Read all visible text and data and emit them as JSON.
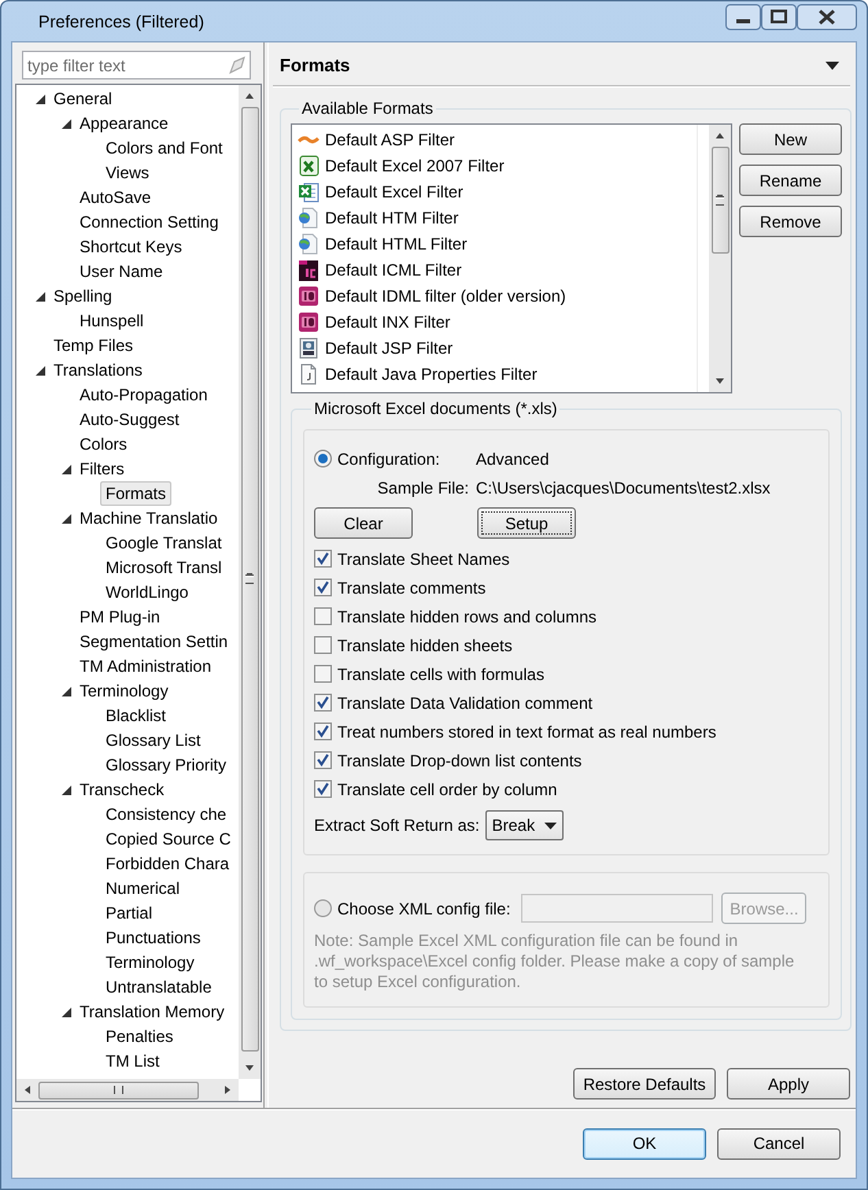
{
  "window": {
    "title": "Preferences (Filtered)"
  },
  "filter": {
    "placeholder": "type filter text"
  },
  "tree": [
    {
      "label": "General",
      "expanded": true,
      "selected": false,
      "children": [
        {
          "label": "Appearance",
          "expanded": true,
          "selected": false,
          "children": [
            {
              "label": "Colors and Font",
              "selected": false
            },
            {
              "label": "Views",
              "selected": false
            }
          ]
        },
        {
          "label": "AutoSave",
          "selected": false
        },
        {
          "label": "Connection Setting",
          "selected": false
        },
        {
          "label": "Shortcut Keys",
          "selected": false
        },
        {
          "label": "User Name",
          "selected": false
        }
      ]
    },
    {
      "label": "Spelling",
      "expanded": true,
      "selected": false,
      "children": [
        {
          "label": "Hunspell",
          "selected": false
        }
      ]
    },
    {
      "label": "Temp Files",
      "selected": false
    },
    {
      "label": "Translations",
      "expanded": true,
      "selected": false,
      "children": [
        {
          "label": "Auto-Propagation",
          "selected": false
        },
        {
          "label": "Auto-Suggest",
          "selected": false
        },
        {
          "label": "Colors",
          "selected": false
        },
        {
          "label": "Filters",
          "expanded": true,
          "selected": false,
          "children": [
            {
              "label": "Formats",
              "selected": true
            }
          ]
        },
        {
          "label": "Machine Translatio",
          "expanded": true,
          "selected": false,
          "children": [
            {
              "label": "Google Translat",
              "selected": false
            },
            {
              "label": "Microsoft Transl",
              "selected": false
            },
            {
              "label": "WorldLingo",
              "selected": false
            }
          ]
        },
        {
          "label": "PM Plug-in",
          "selected": false
        },
        {
          "label": "Segmentation Settin",
          "selected": false
        },
        {
          "label": "TM Administration",
          "selected": false
        },
        {
          "label": "Terminology",
          "expanded": true,
          "selected": false,
          "children": [
            {
              "label": "Blacklist",
              "selected": false
            },
            {
              "label": "Glossary List",
              "selected": false
            },
            {
              "label": "Glossary Priority",
              "selected": false
            }
          ]
        },
        {
          "label": "Transcheck",
          "expanded": true,
          "selected": false,
          "children": [
            {
              "label": "Consistency che",
              "selected": false
            },
            {
              "label": "Copied Source C",
              "selected": false
            },
            {
              "label": "Forbidden Chara",
              "selected": false
            },
            {
              "label": "Numerical",
              "selected": false
            },
            {
              "label": "Partial",
              "selected": false
            },
            {
              "label": "Punctuations",
              "selected": false
            },
            {
              "label": "Terminology",
              "selected": false
            },
            {
              "label": "Untranslatable",
              "selected": false
            }
          ]
        },
        {
          "label": "Translation Memory",
          "expanded": true,
          "selected": false,
          "children": [
            {
              "label": "Penalties",
              "selected": false
            },
            {
              "label": "TM List",
              "selected": false
            }
          ]
        }
      ]
    }
  ],
  "page": {
    "title": "Formats"
  },
  "available_formats": {
    "title": "Available Formats",
    "items": [
      {
        "label": "Default ASP Filter",
        "kind": "asp"
      },
      {
        "label": "Default Excel 2007 Filter",
        "kind": "excel2007"
      },
      {
        "label": "Default Excel Filter",
        "kind": "excel"
      },
      {
        "label": "Default HTM Filter",
        "kind": "web"
      },
      {
        "label": "Default HTML Filter",
        "kind": "web"
      },
      {
        "label": "Default ICML Filter",
        "kind": "incopy"
      },
      {
        "label": "Default IDML filter (older version)",
        "kind": "indesign"
      },
      {
        "label": "Default INX Filter",
        "kind": "indesign"
      },
      {
        "label": "Default JSP Filter",
        "kind": "jsp"
      },
      {
        "label": "Default Java Properties Filter",
        "kind": "java"
      }
    ],
    "buttons": [
      "New",
      "Rename",
      "Remove"
    ]
  },
  "excel": {
    "title": "Microsoft Excel documents (*.xls)",
    "configuration": {
      "label": "Configuration:",
      "value": "Advanced",
      "selected": true
    },
    "sample_file": {
      "label": "Sample File:",
      "value": "C:\\Users\\cjacques\\Documents\\test2.xlsx"
    },
    "buttons": [
      {
        "label": "Clear",
        "focused": false
      },
      {
        "label": "Setup",
        "focused": true
      }
    ],
    "options": [
      {
        "label": "Translate Sheet Names",
        "checked": true
      },
      {
        "label": "Translate comments",
        "checked": true
      },
      {
        "label": "Translate hidden rows and columns",
        "checked": false
      },
      {
        "label": "Translate hidden sheets",
        "checked": false
      },
      {
        "label": "Translate cells with formulas",
        "checked": false
      },
      {
        "label": "Translate Data Validation comment",
        "checked": true
      },
      {
        "label": "Treat numbers stored in text format as real numbers",
        "checked": true
      },
      {
        "label": "Translate Drop-down list contents",
        "checked": true
      },
      {
        "label": "Translate cell order by column",
        "checked": true
      }
    ],
    "soft_return": {
      "label": "Extract Soft Return as:",
      "value": "Break"
    },
    "xml_config": {
      "label": "Choose XML config file:",
      "selected": false,
      "disabled": true,
      "browse": "Browse...",
      "note": "Note: Sample Excel XML configuration file can be found in\n.wf_workspace\\Excel config folder. Please make a copy of sample\nto setup Excel configuration."
    }
  },
  "page_buttons": [
    "Restore Defaults",
    "Apply"
  ],
  "dialog_buttons": [
    {
      "label": "OK",
      "default": true
    },
    {
      "label": "Cancel",
      "default": false
    }
  ]
}
